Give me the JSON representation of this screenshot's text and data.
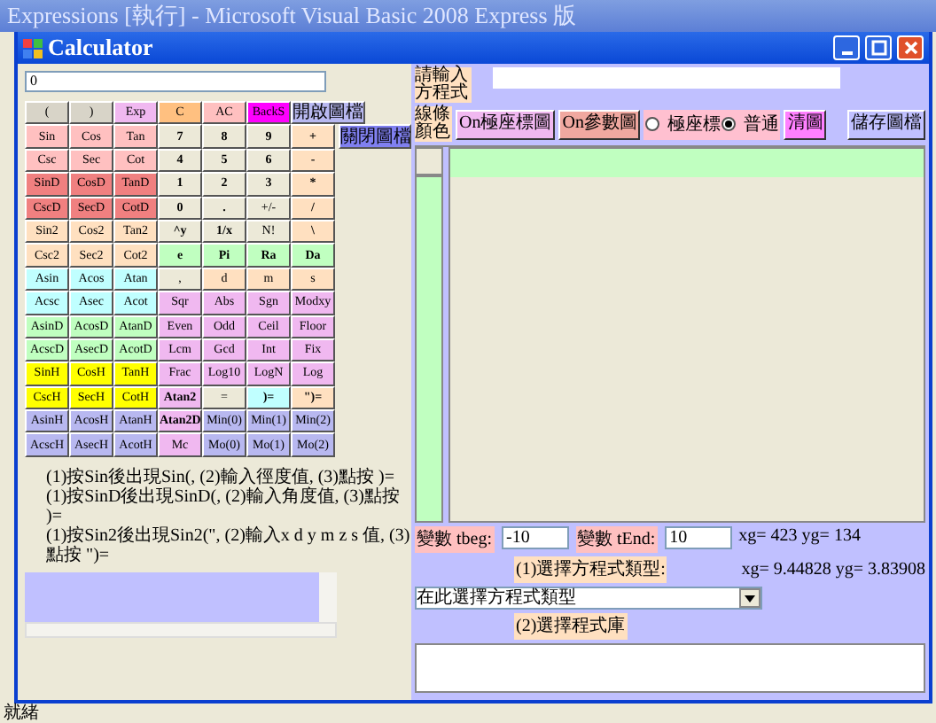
{
  "ide": {
    "title": "Expressions [執行] - Microsoft Visual Basic 2008 Express 版",
    "status": "就緒"
  },
  "window": {
    "title": "Calculator"
  },
  "calculator": {
    "display": "0",
    "keypad": [
      [
        {
          "label": "(",
          "color": "#d8d4c8",
          "bold": false
        },
        {
          "label": ")",
          "color": "#d8d4c8",
          "bold": false
        },
        {
          "label": "Exp",
          "color": "#f0b8f0",
          "bold": false
        },
        {
          "label": "C",
          "color": "#ffc080",
          "bold": false
        },
        {
          "label": "AC",
          "color": "#ffc0c0",
          "bold": false
        },
        {
          "label": "BackS",
          "color": "#ff00ff",
          "bold": false
        },
        {
          "label": "開啟圖檔",
          "color": "#b8b8f0",
          "bold": false
        }
      ],
      [
        {
          "label": "Sin",
          "color": "#ffc0c0",
          "bold": false
        },
        {
          "label": "Cos",
          "color": "#ffc0c0",
          "bold": false
        },
        {
          "label": "Tan",
          "color": "#ffc0c0",
          "bold": false
        },
        {
          "label": "7",
          "color": "#ece9d8",
          "bold": true
        },
        {
          "label": "8",
          "color": "#ece9d8",
          "bold": true
        },
        {
          "label": "9",
          "color": "#ece9d8",
          "bold": true
        },
        {
          "label": "+",
          "color": "#ffe0c0",
          "bold": true
        }
      ],
      [
        {
          "label": "Csc",
          "color": "#ffc0c0",
          "bold": false
        },
        {
          "label": "Sec",
          "color": "#ffc0c0",
          "bold": false
        },
        {
          "label": "Cot",
          "color": "#ffc0c0",
          "bold": false
        },
        {
          "label": "4",
          "color": "#ece9d8",
          "bold": true
        },
        {
          "label": "5",
          "color": "#ece9d8",
          "bold": true
        },
        {
          "label": "6",
          "color": "#ece9d8",
          "bold": true
        },
        {
          "label": "-",
          "color": "#ffe0c0",
          "bold": true
        }
      ],
      [
        {
          "label": "SinD",
          "color": "#f08080",
          "bold": false
        },
        {
          "label": "CosD",
          "color": "#f08080",
          "bold": false
        },
        {
          "label": "TanD",
          "color": "#f08080",
          "bold": false
        },
        {
          "label": "1",
          "color": "#ece9d8",
          "bold": true
        },
        {
          "label": "2",
          "color": "#ece9d8",
          "bold": true
        },
        {
          "label": "3",
          "color": "#ece9d8",
          "bold": true
        },
        {
          "label": "*",
          "color": "#ffe0c0",
          "bold": true
        }
      ],
      [
        {
          "label": "CscD",
          "color": "#f08080",
          "bold": false
        },
        {
          "label": "SecD",
          "color": "#f08080",
          "bold": false
        },
        {
          "label": "CotD",
          "color": "#f08080",
          "bold": false
        },
        {
          "label": "0",
          "color": "#ece9d8",
          "bold": true
        },
        {
          "label": ".",
          "color": "#ece9d8",
          "bold": true
        },
        {
          "label": "+/-",
          "color": "#ece9d8",
          "bold": false
        },
        {
          "label": "/",
          "color": "#ffe0c0",
          "bold": true
        }
      ],
      [
        {
          "label": "Sin2",
          "color": "#ffe0c0",
          "bold": false
        },
        {
          "label": "Cos2",
          "color": "#ffe0c0",
          "bold": false
        },
        {
          "label": "Tan2",
          "color": "#ffe0c0",
          "bold": false
        },
        {
          "label": "^y",
          "color": "#ece9d8",
          "bold": true
        },
        {
          "label": "1/x",
          "color": "#ece9d8",
          "bold": true
        },
        {
          "label": "N!",
          "color": "#ece9d8",
          "bold": false
        },
        {
          "label": "\\",
          "color": "#ffe0c0",
          "bold": true
        }
      ],
      [
        {
          "label": "Csc2",
          "color": "#ffe0c0",
          "bold": false
        },
        {
          "label": "Sec2",
          "color": "#ffe0c0",
          "bold": false
        },
        {
          "label": "Cot2",
          "color": "#ffe0c0",
          "bold": false
        },
        {
          "label": "e",
          "color": "#c0ffc0",
          "bold": true
        },
        {
          "label": "Pi",
          "color": "#c0ffc0",
          "bold": true
        },
        {
          "label": "Ra",
          "color": "#c0ffc0",
          "bold": true
        },
        {
          "label": "Da",
          "color": "#c0ffc0",
          "bold": true
        }
      ],
      [
        {
          "label": "Asin",
          "color": "#c0ffff",
          "bold": false
        },
        {
          "label": "Acos",
          "color": "#c0ffff",
          "bold": false
        },
        {
          "label": "Atan",
          "color": "#c0ffff",
          "bold": false
        },
        {
          "label": ",",
          "color": "#ece9d8",
          "bold": false
        },
        {
          "label": "d",
          "color": "#ffe0c0",
          "bold": false
        },
        {
          "label": "m",
          "color": "#ffe0c0",
          "bold": false
        },
        {
          "label": "s",
          "color": "#ffe0c0",
          "bold": false
        }
      ],
      [
        {
          "label": "Acsc",
          "color": "#c0ffff",
          "bold": false
        },
        {
          "label": "Asec",
          "color": "#c0ffff",
          "bold": false
        },
        {
          "label": "Acot",
          "color": "#c0ffff",
          "bold": false
        },
        {
          "label": "Sqr",
          "color": "#f0b8f0",
          "bold": false
        },
        {
          "label": "Abs",
          "color": "#f0b8f0",
          "bold": false
        },
        {
          "label": "Sgn",
          "color": "#f0b8f0",
          "bold": false
        },
        {
          "label": "Modxy",
          "color": "#f0b8f0",
          "bold": false
        }
      ],
      [
        {
          "label": "AsinD",
          "color": "#c0ffc0",
          "bold": false
        },
        {
          "label": "AcosD",
          "color": "#c0ffc0",
          "bold": false
        },
        {
          "label": "AtanD",
          "color": "#c0ffc0",
          "bold": false
        },
        {
          "label": "Even",
          "color": "#f0b8f0",
          "bold": false
        },
        {
          "label": "Odd",
          "color": "#f0b8f0",
          "bold": false
        },
        {
          "label": "Ceil",
          "color": "#f0b8f0",
          "bold": false
        },
        {
          "label": "Floor",
          "color": "#f0b8f0",
          "bold": false
        }
      ],
      [
        {
          "label": "AcscD",
          "color": "#c0ffc0",
          "bold": false
        },
        {
          "label": "AsecD",
          "color": "#c0ffc0",
          "bold": false
        },
        {
          "label": "AcotD",
          "color": "#c0ffc0",
          "bold": false
        },
        {
          "label": "Lcm",
          "color": "#f0b8f0",
          "bold": false
        },
        {
          "label": "Gcd",
          "color": "#f0b8f0",
          "bold": false
        },
        {
          "label": "Int",
          "color": "#f0b8f0",
          "bold": false
        },
        {
          "label": "Fix",
          "color": "#f0b8f0",
          "bold": false
        }
      ],
      [
        {
          "label": "SinH",
          "color": "#ffff00",
          "bold": false
        },
        {
          "label": "CosH",
          "color": "#ffff00",
          "bold": false
        },
        {
          "label": "TanH",
          "color": "#ffff00",
          "bold": false
        },
        {
          "label": "Frac",
          "color": "#f0b8f0",
          "bold": false
        },
        {
          "label": "Log10",
          "color": "#f0b8f0",
          "bold": false
        },
        {
          "label": "LogN",
          "color": "#f0b8f0",
          "bold": false
        },
        {
          "label": "Log",
          "color": "#f0b8f0",
          "bold": false
        }
      ],
      [
        {
          "label": "CscH",
          "color": "#ffff00",
          "bold": false
        },
        {
          "label": "SecH",
          "color": "#ffff00",
          "bold": false
        },
        {
          "label": "CotH",
          "color": "#ffff00",
          "bold": false
        },
        {
          "label": "Atan2",
          "color": "#f0b8f0",
          "bold": true
        },
        {
          "label": "=",
          "color": "#ece9d8",
          "bold": false
        },
        {
          "label": ")=",
          "color": "#c0ffff",
          "bold": true
        },
        {
          "label": "\")=",
          "color": "#ffe0c0",
          "bold": true
        }
      ],
      [
        {
          "label": "AsinH",
          "color": "#b8b8f0",
          "bold": false
        },
        {
          "label": "AcosH",
          "color": "#b8b8f0",
          "bold": false
        },
        {
          "label": "AtanH",
          "color": "#b8b8f0",
          "bold": false
        },
        {
          "label": "Atan2D",
          "color": "#f0b8f0",
          "bold": true
        },
        {
          "label": "Min(0)",
          "color": "#b8b8f0",
          "bold": false
        },
        {
          "label": "Min(1)",
          "color": "#b8b8f0",
          "bold": false
        },
        {
          "label": "Min(2)",
          "color": "#b8b8f0",
          "bold": false
        }
      ],
      [
        {
          "label": "AcscH",
          "color": "#b8b8f0",
          "bold": false
        },
        {
          "label": "AsecH",
          "color": "#b8b8f0",
          "bold": false
        },
        {
          "label": "AcotH",
          "color": "#b8b8f0",
          "bold": false
        },
        {
          "label": "Mc",
          "color": "#f0b8f0",
          "bold": false
        },
        {
          "label": "Mo(0)",
          "color": "#b8b8f0",
          "bold": false
        },
        {
          "label": "Mo(1)",
          "color": "#b8b8f0",
          "bold": false
        },
        {
          "label": "Mo(2)",
          "color": "#b8b8f0",
          "bold": false
        }
      ]
    ],
    "side_button": "關閉圖檔",
    "help_lines": [
      "(1)按Sin後出現Sin(, (2)輸入徑度值, (3)點按 )=",
      "(1)按SinD後出現SinD(, (2)輸入角度值, (3)點按 )=",
      "(1)按Sin2後出現Sin2(\", (2)輸入x d y m z s 值, (3)點按 \")="
    ]
  },
  "plot": {
    "equation_label": "請輸入方程式",
    "color_label": "線條顏色",
    "buttons": [
      {
        "label": "On極座標圖",
        "color": "#f0b8f0"
      },
      {
        "label": "On參數圖",
        "color": "#f0a8a0"
      }
    ],
    "modes": [
      {
        "label": "極座標",
        "selected": false
      },
      {
        "label": "普通",
        "selected": true
      }
    ],
    "clear": "清圖",
    "save": "儲存圖檔",
    "tbeg_label": "變數 tbeg:",
    "tbeg": "-10",
    "tend_label": "變數 tEnd:",
    "tend": "10",
    "readout": [
      "xg= 423 yg= 134",
      "xg= 9.44828 yg= 3.83908"
    ],
    "type_label": "(1)選擇方程式類型:",
    "type_select": "在此選擇方程式類型",
    "library_label": "(2)選擇程式庫"
  }
}
